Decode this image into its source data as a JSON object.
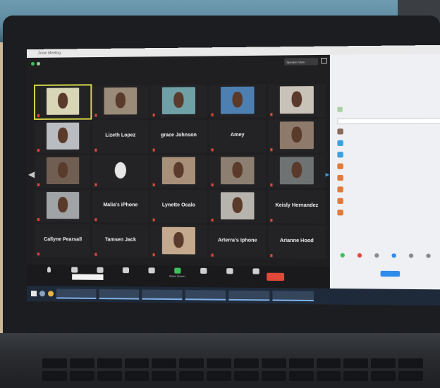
{
  "window": {
    "title": "Zoom Meeting",
    "speaker_view": "Speaker View"
  },
  "tiles": [
    {
      "name": "",
      "big": "",
      "kind": "video",
      "color": "#d9d6b8",
      "active": true
    },
    {
      "name": "",
      "big": "",
      "kind": "video",
      "color": "#9a8a78"
    },
    {
      "name": "",
      "big": "",
      "kind": "video",
      "color": "#6fa0a6"
    },
    {
      "name": "",
      "big": "",
      "kind": "video",
      "color": "#4d7fb0"
    },
    {
      "name": "",
      "big": "",
      "kind": "video",
      "color": "#c9c2b8"
    },
    {
      "name": "",
      "big": "",
      "kind": "video",
      "color": "#b9bcc0"
    },
    {
      "name": "",
      "big": "Lizeth Lopez",
      "kind": "name"
    },
    {
      "name": "",
      "big": "grace Johnson",
      "kind": "name"
    },
    {
      "name": "",
      "big": "Amey",
      "kind": "name"
    },
    {
      "name": "",
      "big": "",
      "kind": "video",
      "color": "#8d7a6a"
    },
    {
      "name": "",
      "big": "",
      "kind": "video",
      "color": "#705e52"
    },
    {
      "name": "",
      "big": "",
      "kind": "phone"
    },
    {
      "name": "",
      "big": "",
      "kind": "video",
      "color": "#a88f7a"
    },
    {
      "name": "",
      "big": "",
      "kind": "video",
      "color": "#8c7e70"
    },
    {
      "name": "",
      "big": "",
      "kind": "video",
      "color": "#6f7272"
    },
    {
      "name": "",
      "big": "",
      "kind": "video",
      "color": "#a0a4a6"
    },
    {
      "name": "",
      "big": "Malia's iPhone",
      "kind": "name"
    },
    {
      "name": "",
      "big": "Lynette Ocalo",
      "kind": "name"
    },
    {
      "name": "",
      "big": "",
      "kind": "video",
      "color": "#b7b3ad"
    },
    {
      "name": "",
      "big": "Keisly Hernandez",
      "kind": "name"
    },
    {
      "name": "",
      "big": "Callyne Pearsall",
      "kind": "name"
    },
    {
      "name": "",
      "big": "Tamsen Jack",
      "kind": "name"
    },
    {
      "name": "",
      "big": "",
      "kind": "video",
      "color": "#c4a98e"
    },
    {
      "name": "",
      "big": "Arterra's Iphone",
      "kind": "name"
    },
    {
      "name": "",
      "big": "Arianne Hood",
      "kind": "name"
    }
  ],
  "toolbar": {
    "mute": "",
    "video": "",
    "security": "",
    "participants": "",
    "chat": "",
    "share": "Share Screen",
    "record": "",
    "reactions": "",
    "more": "",
    "end": ""
  },
  "tooltip": "",
  "taskbar": {
    "items": [
      "",
      "",
      "",
      "",
      "",
      ""
    ],
    "clock": ""
  },
  "panel": {
    "title": "",
    "waiting_header": "",
    "waiting_name": "",
    "in_meeting_header": "",
    "search": "",
    "participants": [
      "",
      "",
      "",
      "",
      "",
      "",
      "",
      ""
    ],
    "reactions": [
      "",
      "",
      "",
      "",
      "",
      ""
    ],
    "button": "",
    "footer": ""
  },
  "colors": {
    "end_red": "#e0483a",
    "share_green": "#3fbf5a",
    "accent_blue": "#2d8ceb"
  }
}
